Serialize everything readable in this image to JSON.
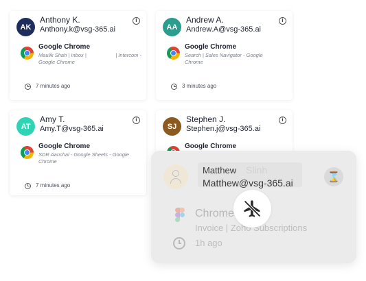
{
  "cards": [
    {
      "initials": "AK",
      "avatar_color": "#1f2d5c",
      "name": "Anthony K.",
      "email": "Anthony.k@vsg-365.ai",
      "app": "Google Chrome",
      "detail": "Maulik Shah | Inbox |",
      "detail_right": "| Intercom -",
      "detail_line2": "Google Chrome",
      "time": "7 minutes ago"
    },
    {
      "initials": "AA",
      "avatar_color": "#2a9d8f",
      "name": "Andrew A.",
      "email": "Andrew.A@vsg-365.ai",
      "app": "Google Chrome",
      "detail": "Search | Sales Navigator - Google",
      "detail_right": "",
      "detail_line2": "Chrome",
      "time": "3 minutes ago"
    },
    {
      "initials": "AT",
      "avatar_color": "#2fd4b5",
      "name": "Amy T.",
      "email": "Amy.T@vsg-365.ai",
      "app": "Google Chrome",
      "detail": "SDR Aanchal - Google Sheets - Google",
      "detail_right": "",
      "detail_line2": "Chrome",
      "time": "7 minutes ago"
    },
    {
      "initials": "SJ",
      "avatar_color": "#8b5a1e",
      "name": "Stephen J.",
      "email": "Stephen.j@vsg-365.ai",
      "app": "Google Chrome",
      "detail": "",
      "detail_right": "",
      "detail_line2": "",
      "time": ""
    }
  ],
  "icons": {
    "info": "info-icon",
    "browser": "chrome-icon",
    "clock": "clock-icon",
    "design_app": "figma-icon",
    "status": "hourglass-icon",
    "action": "airplane-off-icon",
    "profile": "person-icon"
  },
  "overlay": {
    "name": "Matthew",
    "email": "Matthew@vsg-365.ai",
    "placeholder_fragment": "Slinh",
    "app": "Chrome",
    "detail": "Invoice | Zoho Subscriptions",
    "time": "1h ago"
  }
}
